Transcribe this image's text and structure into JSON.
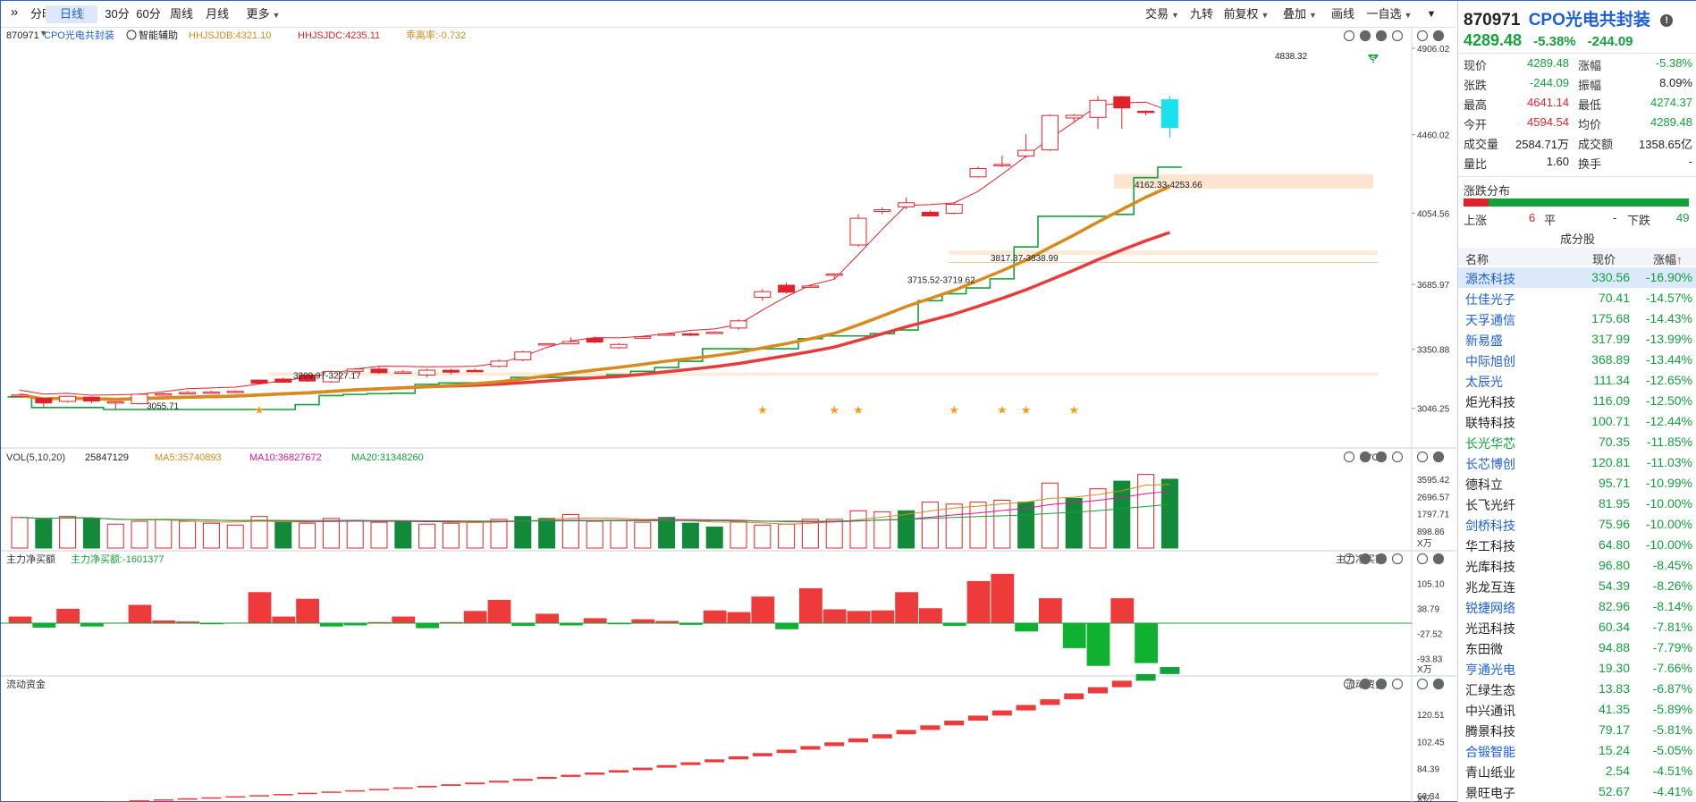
{
  "toolbar": {
    "collapse_icon": "double-chevron-right",
    "tabs": [
      {
        "label": "分时",
        "dropdown": true
      },
      {
        "label": "日线",
        "active": true
      },
      {
        "label": "30分"
      },
      {
        "label": "60分"
      },
      {
        "label": "周线"
      },
      {
        "label": "月线"
      },
      {
        "label": "更多",
        "dropdown": true
      }
    ],
    "right_buttons": [
      {
        "label": "交易",
        "dropdown": true
      },
      {
        "label": "九转"
      },
      {
        "label": "前复权",
        "dropdown": true
      },
      {
        "label": "叠加",
        "dropdown": true
      },
      {
        "label": "画线"
      },
      {
        "label": "一自选",
        "dropdown": true
      }
    ],
    "more_icon": "chevron-down"
  },
  "colors": {
    "up": "#e0232b",
    "down": "#13a13a",
    "ma5": "#d88a1c",
    "ma10": "#e1139b",
    "ma20": "#13a13a",
    "accent": "#1c5fd6",
    "cyan": "#19e2ef"
  },
  "main_panel": {
    "code": "870971",
    "name": "CPO光电共封装",
    "assist": "智能辅助",
    "ind1": "HHJSJDB:4321.10",
    "ind2": "HHJSJDC:4235.11",
    "ind3": "乖离率:-0.732",
    "y_ticks": [
      "4906.02",
      "4460.02",
      "4054.56",
      "3685.97",
      "3350.88",
      "3046.25"
    ],
    "annotations": [
      "4838.32",
      "4162.33-4253.66",
      "3817.37-3838.99",
      "3715.52-3719.62",
      "3209.97-3227.17",
      "3055.71"
    ],
    "signal_label": "S"
  },
  "vol_panel": {
    "title": "VOL(5,10,20)",
    "v": "25847129",
    "ma5": "MA5:35740893",
    "ma10": "MA10:36827672",
    "ma20": "MA20:31348260",
    "tag": "VOL",
    "y_ticks": [
      "3595.42",
      "2696.57",
      "1797.71",
      "898.86"
    ],
    "unit": "X万"
  },
  "flow_panel": {
    "title": "主力净买额",
    "v": "主力净买额:-1601377",
    "tag": "主力净买额",
    "y_ticks": [
      "105.10",
      "38.79",
      "-27.52",
      "-93.83"
    ],
    "unit": "X万"
  },
  "liq_panel": {
    "title": "流动资金",
    "tag": "流动资金",
    "y_ticks": [
      "120.51",
      "102.45",
      "84.39",
      "66.34"
    ],
    "unit": "X亿"
  },
  "chart_data": {
    "type": "candlestick",
    "candles": [
      [
        3111,
        3115,
        3105,
        3112
      ],
      [
        3098,
        3074,
        3050,
        3098
      ],
      [
        3082,
        3108,
        3076,
        3111
      ],
      [
        3104,
        3084,
        3072,
        3108
      ],
      [
        3079,
        3080,
        3040,
        3082
      ],
      [
        3070,
        3119,
        3065,
        3125
      ],
      [
        3120,
        3121,
        3112,
        3127
      ],
      [
        3125,
        3128,
        3118,
        3135
      ],
      [
        3129,
        3130,
        3122,
        3136
      ],
      [
        3128,
        3134,
        3124,
        3139
      ],
      [
        3192,
        3176,
        3170,
        3195
      ],
      [
        3197,
        3181,
        3177,
        3204
      ],
      [
        3218,
        3187,
        3182,
        3224
      ],
      [
        3183,
        3236,
        3178,
        3241
      ],
      [
        3237,
        3249,
        3226,
        3255
      ],
      [
        3249,
        3230,
        3224,
        3262
      ],
      [
        3232,
        3234,
        3224,
        3244
      ],
      [
        3218,
        3243,
        3206,
        3251
      ],
      [
        3243,
        3233,
        3220,
        3250
      ],
      [
        3242,
        3240,
        3237,
        3251
      ],
      [
        3263,
        3290,
        3257,
        3299
      ],
      [
        3297,
        3337,
        3289,
        3343
      ],
      [
        3375,
        3380,
        3373,
        3383
      ],
      [
        3380,
        3391,
        3376,
        3413
      ],
      [
        3408,
        3388,
        3383,
        3417
      ],
      [
        3359,
        3376,
        3354,
        3384
      ],
      [
        3408,
        3416,
        3406,
        3421
      ],
      [
        3427,
        3430,
        3421,
        3432
      ],
      [
        3431,
        3425,
        3420,
        3437
      ],
      [
        3439,
        3439,
        3432,
        3444
      ],
      [
        3461,
        3498,
        3451,
        3508
      ],
      [
        3620,
        3649,
        3602,
        3662
      ],
      [
        3682,
        3646,
        3638,
        3696
      ],
      [
        3675,
        3678,
        3668,
        3680
      ],
      [
        3738,
        3740,
        3715,
        3744
      ],
      [
        3890,
        4028,
        3880,
        4050
      ],
      [
        4063,
        4072,
        4048,
        4085
      ],
      [
        4087,
        4108,
        4075,
        4135
      ],
      [
        4059,
        4040,
        4038,
        4068
      ],
      [
        4054,
        4100,
        4048,
        4110
      ],
      [
        4242,
        4285,
        4238,
        4295
      ],
      [
        4303,
        4306,
        4292,
        4352
      ],
      [
        4350,
        4379,
        4340,
        4462
      ],
      [
        4381,
        4559,
        4376,
        4565
      ],
      [
        4546,
        4560,
        4528,
        4567
      ],
      [
        4549,
        4637,
        4490,
        4660
      ],
      [
        4656,
        4598,
        4490,
        4660
      ],
      [
        4581,
        4574,
        4560,
        4585
      ],
      [
        4640,
        4497,
        4445,
        4660
      ]
    ]
  },
  "quote": {
    "code": "870971",
    "name": "CPO光电共封装",
    "price": "4289.48",
    "pct": "-5.38%",
    "chg": "-244.09",
    "rows": [
      {
        "l1": "现价",
        "v1": "4289.48",
        "c1": "dn",
        "l2": "涨幅",
        "v2": "-5.38%",
        "c2": "dn"
      },
      {
        "l1": "张跌",
        "v1": "-244.09",
        "c1": "dn",
        "l2": "振幅",
        "v2": "8.09%",
        "c2": "blk"
      },
      {
        "l1": "最高",
        "v1": "4641.14",
        "c1": "up",
        "l2": "最低",
        "v2": "4274.37",
        "c2": "dn"
      },
      {
        "l1": "今开",
        "v1": "4594.54",
        "c1": "up",
        "l2": "均价",
        "v2": "4289.48",
        "c2": "dn"
      },
      {
        "l1": "成交量",
        "v1": "2584.71万",
        "c1": "blk",
        "l2": "成交额",
        "v2": "1358.65亿",
        "c2": "blk"
      },
      {
        "l1": "量比",
        "v1": "1.60",
        "c1": "blk",
        "l2": "换手",
        "v2": "-",
        "c2": "blk"
      }
    ]
  },
  "distribution": {
    "title": "涨跌分布",
    "up_label": "上涨",
    "up_count": "6",
    "flat_label": "平",
    "flat_count": "-",
    "down_label": "下跌",
    "down_count": "49",
    "up_ratio": 0.11
  },
  "constituents": {
    "title": "成分股",
    "headers": [
      "名称",
      "现价",
      "涨幅"
    ],
    "sort_icon": "arrow-up",
    "rows": [
      {
        "name": "源杰科技",
        "price": "330.56",
        "chg": "-16.90%",
        "blue": true,
        "sel": true
      },
      {
        "name": "仕佳光子",
        "price": "70.41",
        "chg": "-14.57%",
        "blue": true
      },
      {
        "name": "天孚通信",
        "price": "175.68",
        "chg": "-14.43%",
        "blue": true
      },
      {
        "name": "新易盛",
        "price": "317.99",
        "chg": "-13.99%",
        "blue": true
      },
      {
        "name": "中际旭创",
        "price": "368.89",
        "chg": "-13.44%",
        "blue": true
      },
      {
        "name": "太辰光",
        "price": "111.34",
        "chg": "-12.65%",
        "blue": true
      },
      {
        "name": "炬光科技",
        "price": "116.09",
        "chg": "-12.50%"
      },
      {
        "name": "联特科技",
        "price": "100.71",
        "chg": "-12.44%"
      },
      {
        "name": "长光华芯",
        "price": "70.35",
        "chg": "-11.85%",
        "green": true
      },
      {
        "name": "长芯博创",
        "price": "120.81",
        "chg": "-11.03%",
        "blue": true
      },
      {
        "name": "德科立",
        "price": "95.71",
        "chg": "-10.99%"
      },
      {
        "name": "长飞光纤",
        "price": "81.95",
        "chg": "-10.00%"
      },
      {
        "name": "剑桥科技",
        "price": "75.96",
        "chg": "-10.00%",
        "blue": true
      },
      {
        "name": "华工科技",
        "price": "64.80",
        "chg": "-10.00%"
      },
      {
        "name": "光库科技",
        "price": "96.80",
        "chg": "-8.45%"
      },
      {
        "name": "兆龙互连",
        "price": "54.39",
        "chg": "-8.26%"
      },
      {
        "name": "锐捷网络",
        "price": "82.96",
        "chg": "-8.14%",
        "blue": true
      },
      {
        "name": "光迅科技",
        "price": "60.34",
        "chg": "-7.81%"
      },
      {
        "name": "东田微",
        "price": "94.88",
        "chg": "-7.79%"
      },
      {
        "name": "亨通光电",
        "price": "19.30",
        "chg": "-7.66%",
        "blue": true
      },
      {
        "name": "汇绿生态",
        "price": "13.83",
        "chg": "-6.87%"
      },
      {
        "name": "中兴通讯",
        "price": "41.35",
        "chg": "-5.89%"
      },
      {
        "name": "腾景科技",
        "price": "79.17",
        "chg": "-5.81%"
      },
      {
        "name": "合锻智能",
        "price": "15.24",
        "chg": "-5.05%",
        "blue": true
      },
      {
        "name": "青山纸业",
        "price": "2.54",
        "chg": "-4.51%"
      },
      {
        "name": "景旺电子",
        "price": "52.67",
        "chg": "-4.41%"
      }
    ]
  }
}
